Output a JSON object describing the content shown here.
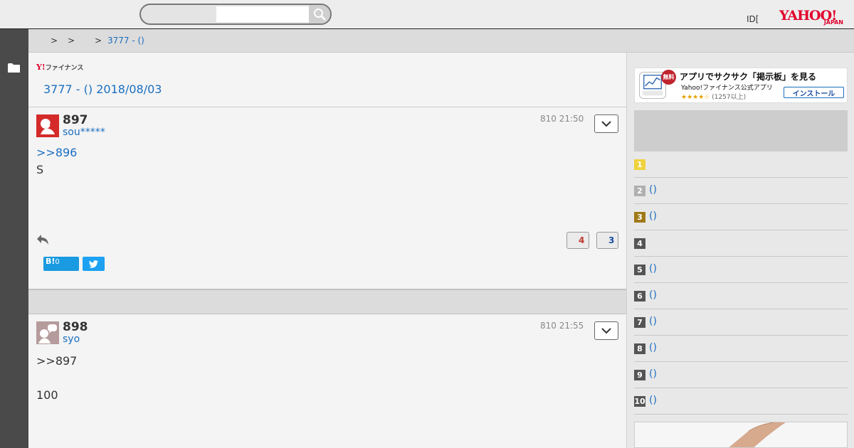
{
  "header": {
    "search": {
      "value": "",
      "placeholder": ""
    },
    "id_link": "ID[",
    "logo": {
      "main": "YAHOO!",
      "sub": "JAPAN"
    }
  },
  "breadcrumb": {
    "separators": [
      ">",
      ">",
      ">"
    ],
    "current": "3777 - ()"
  },
  "main": {
    "fin_logo": {
      "y": "Y!",
      "text": "ファイナンス"
    },
    "board_title": "3777 - () 2018/08/03",
    "posts": [
      {
        "number": "897",
        "user": "sou*****",
        "time": "810 21:50",
        "reply_link": ">>896",
        "body": "S",
        "votes": {
          "up": "4",
          "down": "3"
        },
        "hatena": {
          "label": "B!",
          "count": "0"
        }
      },
      {
        "number": "898",
        "user": "syo",
        "time": "810 21:55",
        "body_lines": [
          ">>897",
          "",
          "100"
        ]
      }
    ]
  },
  "right": {
    "app_banner": {
      "badge": "無料",
      "title": "アプリでサクサク「掲示板」を見る",
      "subtitle": "Yahoo!ファイナンス公式アプリ",
      "stars": "★★★★☆",
      "review_count": "(1257以上)",
      "install": "インストール"
    },
    "ranking": [
      {
        "rank": "1",
        "label": "",
        "color": "#f0d23c"
      },
      {
        "rank": "2",
        "label": "()",
        "color": "#b0b0b0"
      },
      {
        "rank": "3",
        "label": "()",
        "color": "#a07a18"
      },
      {
        "rank": "4",
        "label": "",
        "color": "#555555"
      },
      {
        "rank": "5",
        "label": "()",
        "color": "#555555"
      },
      {
        "rank": "6",
        "label": "()",
        "color": "#555555"
      },
      {
        "rank": "7",
        "label": "()",
        "color": "#555555"
      },
      {
        "rank": "8",
        "label": "()",
        "color": "#555555"
      },
      {
        "rank": "9",
        "label": "()",
        "color": "#555555"
      },
      {
        "rank": "10",
        "label": "()",
        "color": "#555555"
      }
    ]
  },
  "colors": {
    "link": "#1a6fc0",
    "brand": "#e0002c",
    "rail": "#4a4a4a"
  }
}
